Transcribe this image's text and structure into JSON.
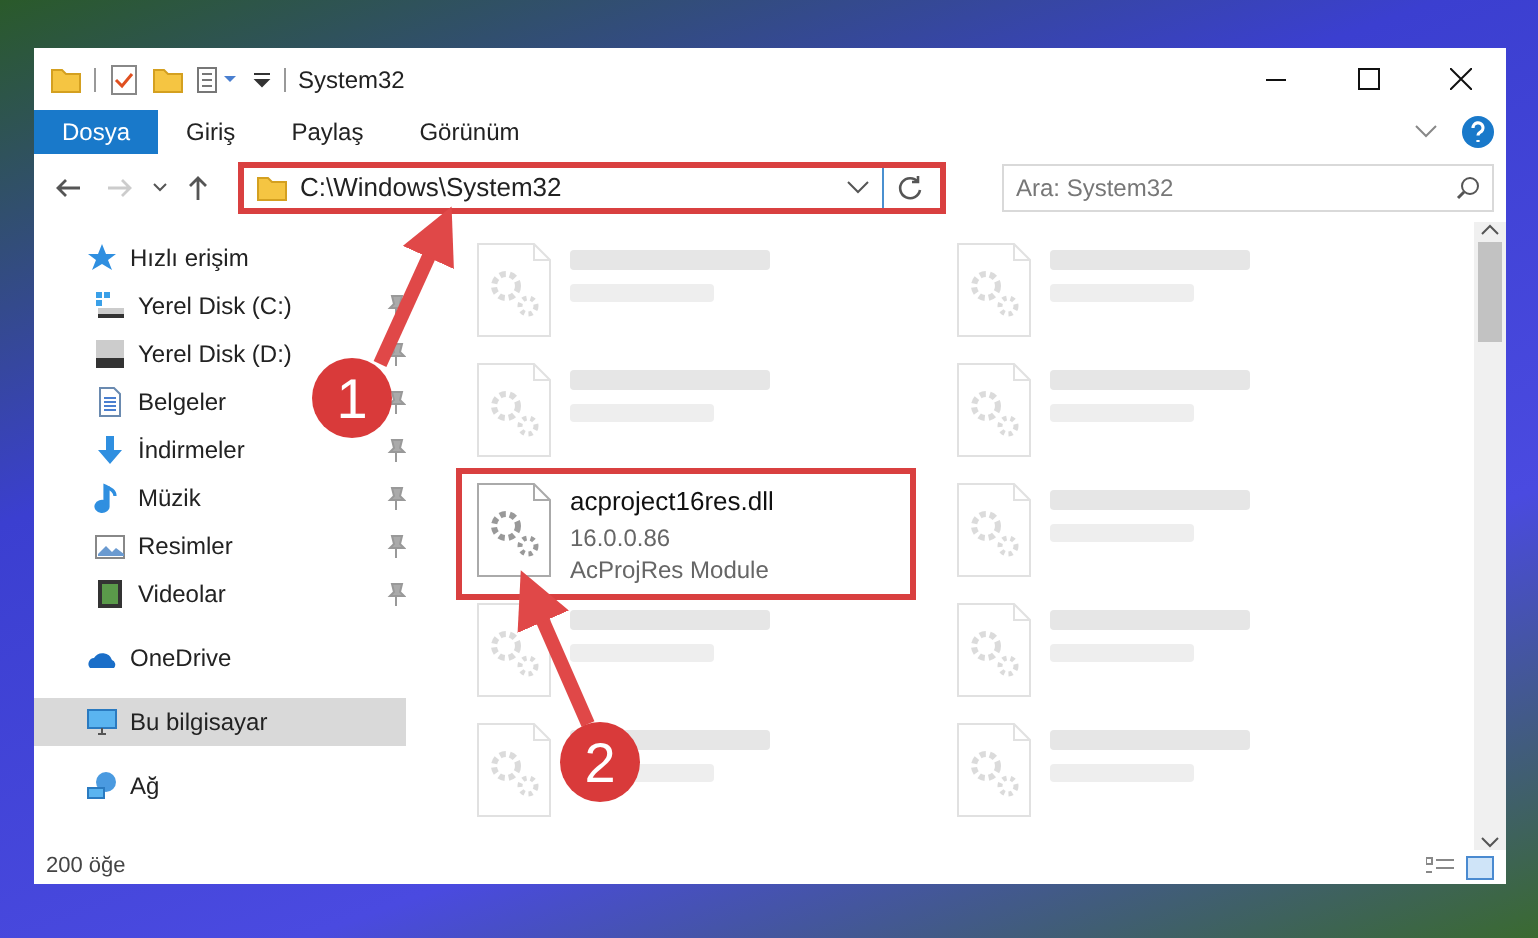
{
  "title_bar": {
    "title": "System32"
  },
  "ribbon_tabs": [
    {
      "label": "Dosya",
      "selected": true
    },
    {
      "label": "Giriş",
      "selected": false
    },
    {
      "label": "Paylaş",
      "selected": false
    },
    {
      "label": "Görünüm",
      "selected": false
    }
  ],
  "navigation": {
    "back_disabled": false,
    "forward_disabled": true
  },
  "address_bar": {
    "path": "C:\\Windows\\System32",
    "highlighted": true
  },
  "search": {
    "placeholder": "Ara: System32"
  },
  "sidebar": {
    "items": [
      {
        "label": "Hızlı erişim",
        "kind": "star",
        "selected": false,
        "children": [
          {
            "label": "Yerel Disk (C:)",
            "kind": "drive-windows",
            "pinned": true,
            "selected": false
          },
          {
            "label": "Yerel Disk (D:)",
            "kind": "drive",
            "pinned": true,
            "selected": false
          },
          {
            "label": "Belgeler",
            "kind": "document",
            "pinned": true,
            "selected": false
          },
          {
            "label": "İndirmeler",
            "kind": "download",
            "pinned": true,
            "selected": false
          },
          {
            "label": "Müzik",
            "kind": "music",
            "pinned": true,
            "selected": false
          },
          {
            "label": "Resimler",
            "kind": "pictures",
            "pinned": true,
            "selected": false
          },
          {
            "label": "Videolar",
            "kind": "video",
            "pinned": true,
            "selected": false
          }
        ]
      },
      {
        "label": "OneDrive",
        "kind": "cloud",
        "selected": false
      },
      {
        "label": "Bu bilgisayar",
        "kind": "computer",
        "selected": true
      },
      {
        "label": "Ağ",
        "kind": "network",
        "selected": false
      }
    ]
  },
  "files": [
    {
      "kind": "blurred"
    },
    {
      "kind": "blurred"
    },
    {
      "kind": "blurred"
    },
    {
      "kind": "blurred"
    },
    {
      "kind": "file",
      "name": "acproject16res.dll",
      "version": "16.0.0.86",
      "description": "AcProjRes Module",
      "highlighted": true
    },
    {
      "kind": "blurred"
    },
    {
      "kind": "blurred"
    },
    {
      "kind": "blurred"
    },
    {
      "kind": "blurred"
    },
    {
      "kind": "blurred"
    }
  ],
  "status_bar": {
    "item_count": "200 öğe"
  },
  "callouts": [
    {
      "number": "1"
    },
    {
      "number": "2"
    }
  ]
}
